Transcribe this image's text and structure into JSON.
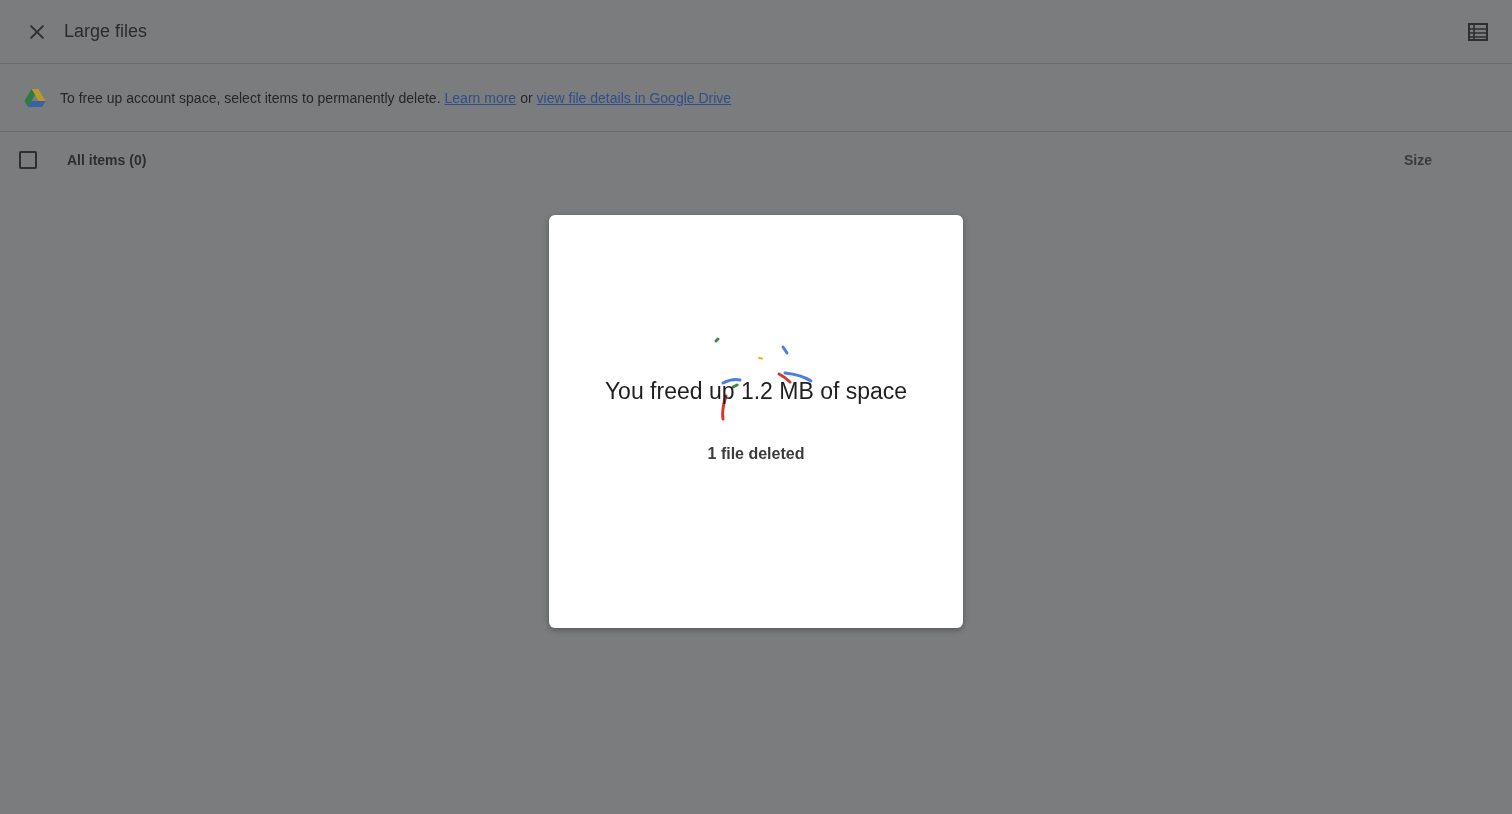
{
  "header": {
    "title": "Large files"
  },
  "notice": {
    "text": "To free up account space, select items to permanently delete.",
    "link_1": "Learn more",
    "joiner": "or",
    "link_2": "view file details in Google Drive"
  },
  "list_header": {
    "checked": false,
    "label": "All items (0)",
    "size_label": "Size"
  },
  "dialog": {
    "title": "You freed up 1.2 MB of space",
    "subtitle": "1 file deleted"
  }
}
